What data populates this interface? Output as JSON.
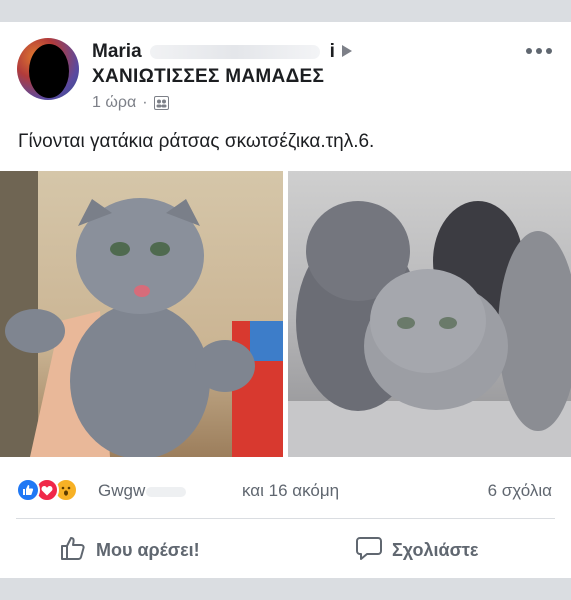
{
  "post": {
    "author_first": "Maria",
    "author_tail": "i",
    "group": "ΧΑΝΙΩΤΙΣΣΕΣ ΜΑΜΑΔΕΣ",
    "time": "1 ώρα",
    "dot": "·",
    "body": "Γίνονται γατάκια ράτσας σκωτσέζικα.τηλ.6.",
    "icons": {
      "more": "more-options-icon",
      "audience": "group-audience-icon",
      "arrow": "arrow-right-icon"
    }
  },
  "reactions": {
    "reactor": "Gwgw",
    "others": "και 16 ακόμη",
    "comments": "6 σχόλια",
    "types": [
      "like",
      "love",
      "wow"
    ],
    "colors": {
      "like": "#2078f4",
      "love": "#f02849",
      "wow": "#f7b125"
    }
  },
  "actions": {
    "like": "Μου αρέσει!",
    "comment": "Σχολιάστε"
  },
  "colors": {
    "text": "#1c1e21",
    "secondary": "#606770",
    "border": "#dadde1"
  }
}
